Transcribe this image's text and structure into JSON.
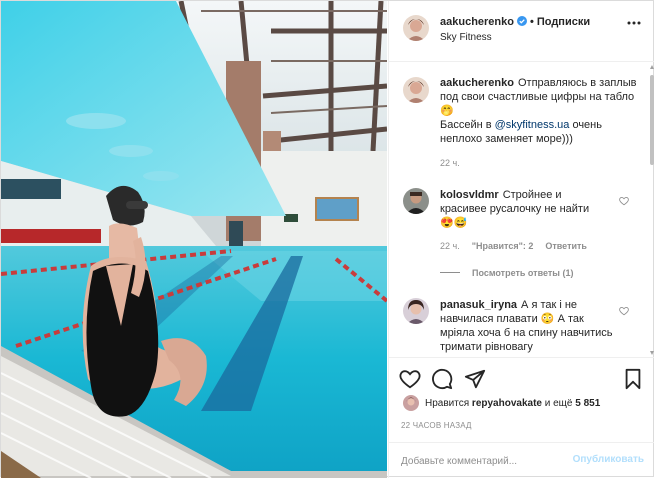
{
  "post": {
    "username": "aakucherenko",
    "separator": "•",
    "follow_label": "Подписки",
    "location": "Sky Fitness"
  },
  "caption": {
    "username": "aakucherenko",
    "text_line1": "Отправляюсь в заплыв под свои счастливые цифры на табло",
    "emoji1": "🤭",
    "text_line2_pre": "Бассейн в ",
    "mention": "@skyfitness.ua",
    "text_line2_post": " очень неплохо заменяет море)))",
    "time": "22 ч."
  },
  "comments": [
    {
      "username": "kolosvldmr",
      "text": "Стройнее и красивее русалочку не найти",
      "emojis": "😍😅",
      "time": "22 ч.",
      "likes": "\"Нравится\": 2",
      "reply_label": "Ответить",
      "view_replies": "Посмотреть ответы (1)"
    },
    {
      "username": "panasuk_iryna",
      "text_pre": "А я так і не навчилася плавати",
      "emoji": "😳",
      "text_post": "А так мріяла хоча б на спину навчитись тримати рівновагу"
    }
  ],
  "likes": {
    "prefix": "Нравится",
    "user": "repyahovakate",
    "mid": "и ещё",
    "count": "5 851"
  },
  "post_time": "22 ЧАСОВ НАЗАД",
  "add_comment": {
    "placeholder": "Добавьте комментарий...",
    "publish_label": "Опубликовать"
  },
  "colors": {
    "verified": "#3897f0",
    "link": "#00376b",
    "muted": "#8e8e8e",
    "publish_disabled": "#b2dffc",
    "pool_water": "#1ab8d4"
  },
  "icons": [
    "verified-icon",
    "more-options-icon",
    "heart-icon",
    "comment-icon",
    "share-icon",
    "bookmark-icon"
  ]
}
